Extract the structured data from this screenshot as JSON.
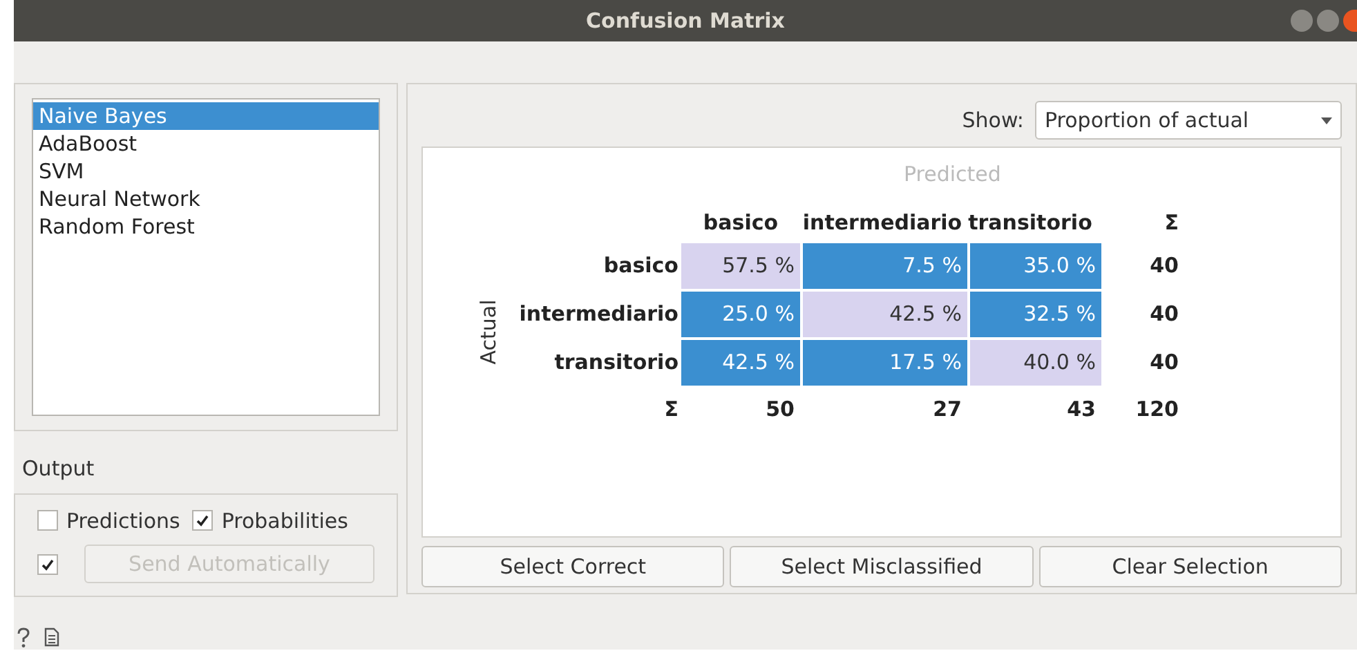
{
  "window": {
    "title": "Confusion Matrix"
  },
  "learners": [
    {
      "label": "Naive Bayes",
      "selected": true
    },
    {
      "label": "AdaBoost",
      "selected": false
    },
    {
      "label": "SVM",
      "selected": false
    },
    {
      "label": "Neural Network",
      "selected": false
    },
    {
      "label": "Random Forest",
      "selected": false
    }
  ],
  "output": {
    "title": "Output",
    "options": [
      {
        "label": "Predictions",
        "checked": false
      },
      {
        "label": "Probabilities",
        "checked": true
      }
    ],
    "auto_send": {
      "checked": true,
      "label": "Send Automatically",
      "disabled": true
    }
  },
  "show": {
    "label": "Show:",
    "value": "Proportion of actual"
  },
  "matrix": {
    "predicted_label": "Predicted",
    "actual_label": "Actual",
    "columns": [
      "basico",
      "intermediario",
      "transitorio"
    ],
    "sum_header": "Σ",
    "rows": [
      {
        "label": "basico",
        "cells": [
          {
            "value": "57.5 %",
            "kind": "correct"
          },
          {
            "value": "7.5 %",
            "kind": "error"
          },
          {
            "value": "35.0 %",
            "kind": "error"
          }
        ],
        "sum": "40"
      },
      {
        "label": "intermediario",
        "cells": [
          {
            "value": "25.0 %",
            "kind": "error"
          },
          {
            "value": "42.5 %",
            "kind": "correct"
          },
          {
            "value": "32.5 %",
            "kind": "error"
          }
        ],
        "sum": "40"
      },
      {
        "label": "transitorio",
        "cells": [
          {
            "value": "42.5 %",
            "kind": "error"
          },
          {
            "value": "17.5 %",
            "kind": "error"
          },
          {
            "value": "40.0 %",
            "kind": "correct"
          }
        ],
        "sum": "40"
      }
    ],
    "totals": {
      "label": "Σ",
      "values": [
        "50",
        "27",
        "43"
      ],
      "total": "120"
    }
  },
  "buttons": [
    "Select Correct",
    "Select Misclassified",
    "Clear Selection"
  ]
}
